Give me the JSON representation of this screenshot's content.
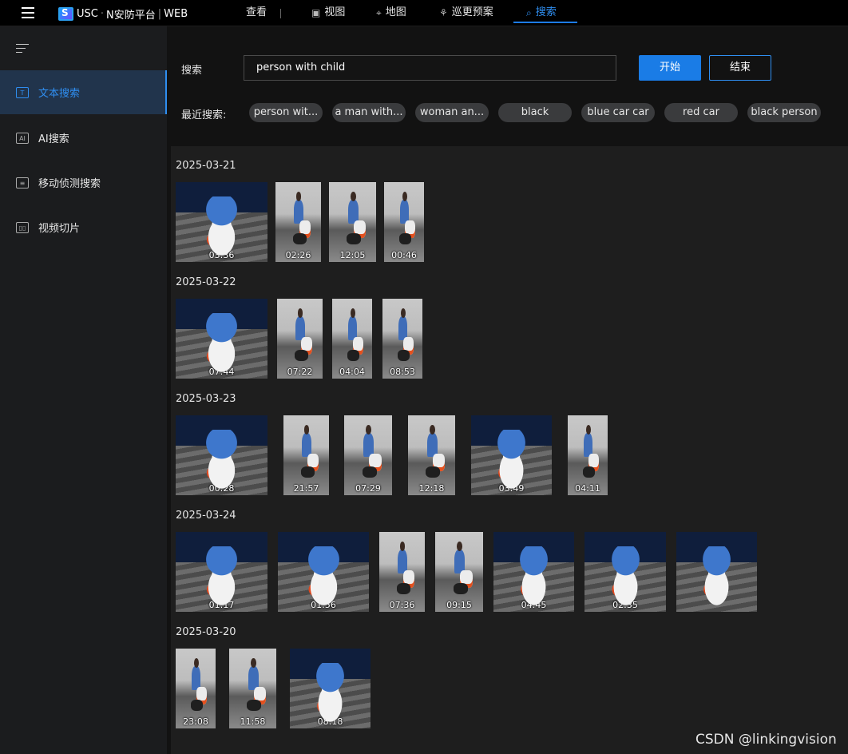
{
  "topbar": {
    "brand_usc": "USC",
    "brand_rest": "N安防平台",
    "brand_web": "WEB",
    "nav": [
      {
        "label": "查看"
      },
      {
        "label": "视图"
      },
      {
        "label": "地图"
      },
      {
        "label": "巡更预案"
      },
      {
        "label": "搜索"
      }
    ]
  },
  "sidebar": {
    "items": [
      {
        "label": "文本搜索",
        "icon": "text-search-icon",
        "active": true
      },
      {
        "label": "AI搜索",
        "icon": "ai-search-icon",
        "active": false
      },
      {
        "label": "移动侦测搜索",
        "icon": "motion-search-icon",
        "active": false
      },
      {
        "label": "视频切片",
        "icon": "video-clip-icon",
        "active": false
      }
    ]
  },
  "search": {
    "label": "搜索",
    "value": "person with child",
    "start_label": "开始",
    "end_label": "结束",
    "recent_label": "最近搜索:",
    "recent": [
      "person wit...",
      "a man with...",
      "woman an...",
      "black",
      "blue car car",
      "red car",
      "black person"
    ]
  },
  "results": [
    {
      "date": "2025-03-21",
      "thumbs": [
        {
          "time": "03:36",
          "kind": "wide"
        },
        {
          "time": "02:26",
          "kind": "narrow"
        },
        {
          "time": "12:05",
          "kind": "narrow"
        },
        {
          "time": "00:46",
          "kind": "narrow"
        }
      ]
    },
    {
      "date": "2025-03-22",
      "thumbs": [
        {
          "time": "07:44",
          "kind": "wide"
        },
        {
          "time": "07:22",
          "kind": "narrow"
        },
        {
          "time": "04:04",
          "kind": "narrow"
        },
        {
          "time": "08:53",
          "kind": "narrow"
        }
      ]
    },
    {
      "date": "2025-03-23",
      "thumbs": [
        {
          "time": "00:28",
          "kind": "wide"
        },
        {
          "time": "21:57",
          "kind": "narrow"
        },
        {
          "time": "07:29",
          "kind": "narrow"
        },
        {
          "time": "12:18",
          "kind": "narrow"
        },
        {
          "time": "03:49",
          "kind": "wide"
        },
        {
          "time": "04:11",
          "kind": "narrow"
        }
      ]
    },
    {
      "date": "2025-03-24",
      "thumbs": [
        {
          "time": "01:17",
          "kind": "wide"
        },
        {
          "time": "01:56",
          "kind": "wide"
        },
        {
          "time": "07:36",
          "kind": "narrow"
        },
        {
          "time": "09:15",
          "kind": "narrow"
        },
        {
          "time": "04:45",
          "kind": "wide"
        },
        {
          "time": "02:35",
          "kind": "wide"
        },
        {
          "time": "",
          "kind": "wide"
        }
      ]
    },
    {
      "date": "2025-03-20",
      "thumbs": [
        {
          "time": "23:08",
          "kind": "narrow"
        },
        {
          "time": "11:58",
          "kind": "narrow"
        },
        {
          "time": "08:18",
          "kind": "wide"
        }
      ]
    }
  ],
  "watermark": "CSDN @linkingvision",
  "colors": {
    "accent": "#1a7ce6",
    "sidebar_active_bg": "#21344c",
    "background": "#121212"
  }
}
